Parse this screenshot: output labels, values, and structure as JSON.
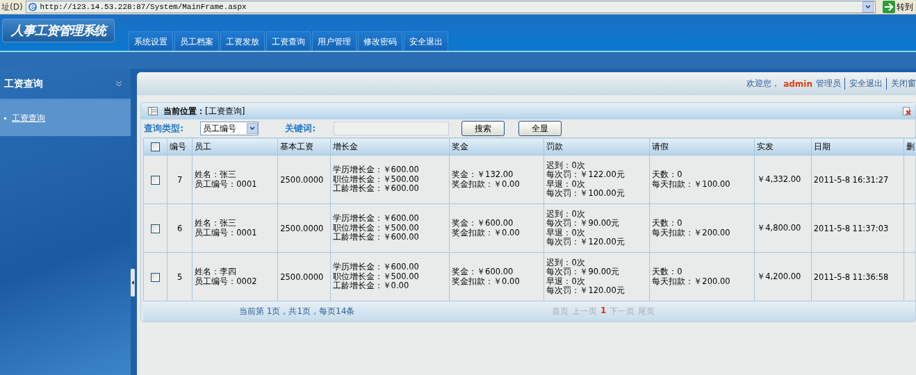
{
  "address_bar": {
    "label": "址(D)",
    "url": "http://123.14.53.228:87/System/MainFrame.aspx",
    "go_label": "转到"
  },
  "header": {
    "logo": "人事工资管理系统",
    "nav": [
      {
        "label": "系统设置"
      },
      {
        "label": "员工档案"
      },
      {
        "label": "工资发放"
      },
      {
        "label": "工资查询"
      },
      {
        "label": "用户管理"
      },
      {
        "label": "修改密码"
      },
      {
        "label": "安全退出"
      }
    ]
  },
  "sidebar": {
    "title": "工资查询",
    "items": [
      {
        "label": "工资查询",
        "selected": true
      }
    ]
  },
  "welcome": {
    "prefix": "欢迎您，",
    "user": "admin",
    "role": "管理员",
    "links": [
      "安全退出",
      "关闭窗"
    ]
  },
  "panel": {
    "location_label": "当前位置：",
    "location": "[工资查询]"
  },
  "search": {
    "type_label": "查询类型:",
    "type_value": "员工编号",
    "keyword_label": "关键词:",
    "buttons": [
      "搜索",
      "全显"
    ]
  },
  "table": {
    "select_all_checked": false,
    "columns": [
      "编号",
      "员工",
      "基本工资",
      "增长金",
      "奖金",
      "罚款",
      "请假",
      "实发",
      "日期",
      "删"
    ],
    "rows": [
      {
        "checked": false,
        "id": "7",
        "employee": [
          "姓名：张三",
          "员工编号：0001"
        ],
        "base": "2500.0000",
        "raise": [
          "学历增长金：￥600.00",
          "职位增长金：￥500.00",
          "工龄增长金：￥600.00"
        ],
        "bonus": [
          "奖金：￥132.00",
          "奖金扣款：￥0.00"
        ],
        "fine": [
          "迟到：0次",
          "每次罚：￥122.00元",
          "早退：0次",
          "每次罚：￥100.00元"
        ],
        "leave": [
          "天数：0",
          "每天扣款：￥100.00"
        ],
        "paid": "￥4,332.00",
        "date": "2011-5-8 16:31:27"
      },
      {
        "checked": false,
        "id": "6",
        "employee": [
          "姓名：张三",
          "员工编号：0001"
        ],
        "base": "2500.0000",
        "raise": [
          "学历增长金：￥600.00",
          "职位增长金：￥500.00",
          "工龄增长金：￥600.00"
        ],
        "bonus": [
          "奖金：￥600.00",
          "奖金扣款：￥0.00"
        ],
        "fine": [
          "迟到：0次",
          "每次罚：￥90.00元",
          "早退：0次",
          "每次罚：￥120.00元"
        ],
        "leave": [
          "天数：0",
          "每天扣款：￥200.00"
        ],
        "paid": "￥4,800.00",
        "date": "2011-5-8 11:37:03"
      },
      {
        "checked": false,
        "id": "5",
        "employee": [
          "姓名：李四",
          "员工编号：0002"
        ],
        "base": "2500.0000",
        "raise": [
          "学历增长金：￥600.00",
          "职位增长金：￥500.00",
          "工龄增长金：￥0.00"
        ],
        "bonus": [
          "奖金：￥600.00",
          "奖金扣款：￥0.00"
        ],
        "fine": [
          "迟到：0次",
          "每次罚：￥90.00元",
          "早退：0次",
          "每次罚：￥120.00元"
        ],
        "leave": [
          "天数：0",
          "每天扣款：￥200.00"
        ],
        "paid": "￥4,200.00",
        "date": "2011-5-8 11:36:58"
      }
    ]
  },
  "pager": {
    "summary": "当前第 1页，共1页，每页14条",
    "links": [
      {
        "label": "首页",
        "current": false
      },
      {
        "label": "上一页",
        "current": false
      },
      {
        "label": "1",
        "current": true
      },
      {
        "label": "下一页",
        "current": false
      },
      {
        "label": "尾页",
        "current": false
      }
    ]
  }
}
